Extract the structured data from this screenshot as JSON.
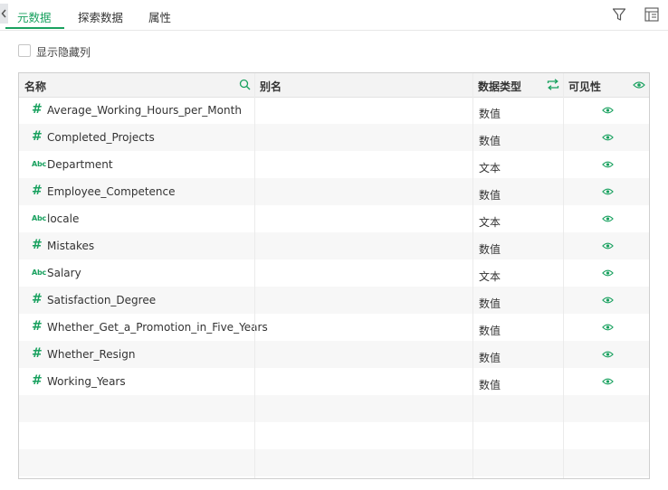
{
  "tabs": [
    {
      "label": "元数据",
      "active": true
    },
    {
      "label": "探索数据",
      "active": false
    },
    {
      "label": "属性",
      "active": false
    }
  ],
  "toolbar": {
    "filter_icon": "filter-icon",
    "layout_icon": "column-layout-icon"
  },
  "show_hidden": {
    "label": "显示隐藏列",
    "checked": false
  },
  "columns": {
    "name": "名称",
    "alias": "别名",
    "data_type": "数据类型",
    "visibility": "可见性"
  },
  "fields": [
    {
      "type_icon": "#",
      "kind": "num",
      "name": "Average_Working_Hours_per_Month",
      "alias": "",
      "data_type": "数值",
      "visible": true
    },
    {
      "type_icon": "#",
      "kind": "num",
      "name": "Completed_Projects",
      "alias": "",
      "data_type": "数值",
      "visible": true
    },
    {
      "type_icon": "Abc",
      "kind": "txt",
      "name": "Department",
      "alias": "",
      "data_type": "文本",
      "visible": true
    },
    {
      "type_icon": "#",
      "kind": "num",
      "name": "Employee_Competence",
      "alias": "",
      "data_type": "数值",
      "visible": true
    },
    {
      "type_icon": "Abc",
      "kind": "txt",
      "name": "locale",
      "alias": "",
      "data_type": "文本",
      "visible": true
    },
    {
      "type_icon": "#",
      "kind": "num",
      "name": "Mistakes",
      "alias": "",
      "data_type": "数值",
      "visible": true
    },
    {
      "type_icon": "Abc",
      "kind": "txt",
      "name": "Salary",
      "alias": "",
      "data_type": "文本",
      "visible": true
    },
    {
      "type_icon": "#",
      "kind": "num",
      "name": "Satisfaction_Degree",
      "alias": "",
      "data_type": "数值",
      "visible": true
    },
    {
      "type_icon": "#",
      "kind": "num",
      "name": "Whether_Get_a_Promotion_in_Five_Years",
      "alias": "",
      "data_type": "数值",
      "visible": true
    },
    {
      "type_icon": "#",
      "kind": "num",
      "name": "Whether_Resign",
      "alias": "",
      "data_type": "数值",
      "visible": true
    },
    {
      "type_icon": "#",
      "kind": "num",
      "name": "Working_Years",
      "alias": "",
      "data_type": "数值",
      "visible": true
    }
  ],
  "colors": {
    "accent": "#19a15f",
    "row_alt": "#f7f7f7",
    "header_bg": "#f3f3f3"
  }
}
